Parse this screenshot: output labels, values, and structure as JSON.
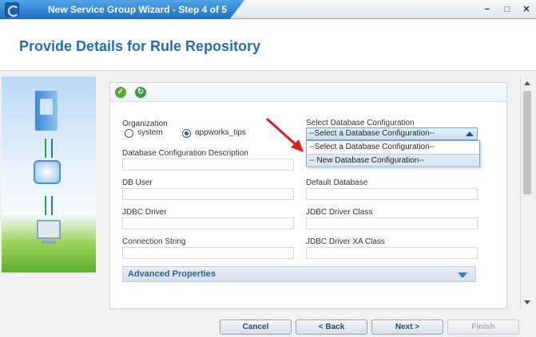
{
  "window": {
    "title": "New Service Group Wizard - Step 4 of 5",
    "minimize": "−",
    "maximize": "□",
    "close": "✕"
  },
  "header": {
    "title": "Provide Details for Rule Repository"
  },
  "toolbar": {
    "icons": [
      "check-icon",
      "refresh-icon"
    ]
  },
  "form": {
    "organization_label": "Organization",
    "org_options": [
      {
        "label": "system",
        "checked": false
      },
      {
        "label": "appworks_tips",
        "checked": true
      }
    ],
    "db_config_label": "Select Database Configuration",
    "db_config_selected": "--Select a Database Configuration--",
    "db_config_options": [
      "--Select a Database Configuration--",
      "-- New Database Configuration--"
    ],
    "db_config_desc_label": "Database Configuration Description",
    "db_config_desc_value": "",
    "db_user_label": "DB User",
    "db_user_value": "",
    "default_db_label": "Default Database",
    "default_db_value": "",
    "jdbc_driver_label": "JDBC Driver",
    "jdbc_driver_value": "",
    "jdbc_driver_class_label": "JDBC Driver Class",
    "jdbc_driver_class_value": "",
    "connection_string_label": "Connection String",
    "connection_string_value": "",
    "jdbc_driver_xa_label": "JDBC Driver XA Class",
    "jdbc_driver_xa_value": "",
    "advanced_label": "Advanced Properties"
  },
  "footer": {
    "cancel": "Cancel",
    "back": "< Back",
    "next": "Next >",
    "finish": "Finish"
  },
  "colors": {
    "accent": "#1f6fb8",
    "annotation_arrow": "#e31b1b"
  }
}
